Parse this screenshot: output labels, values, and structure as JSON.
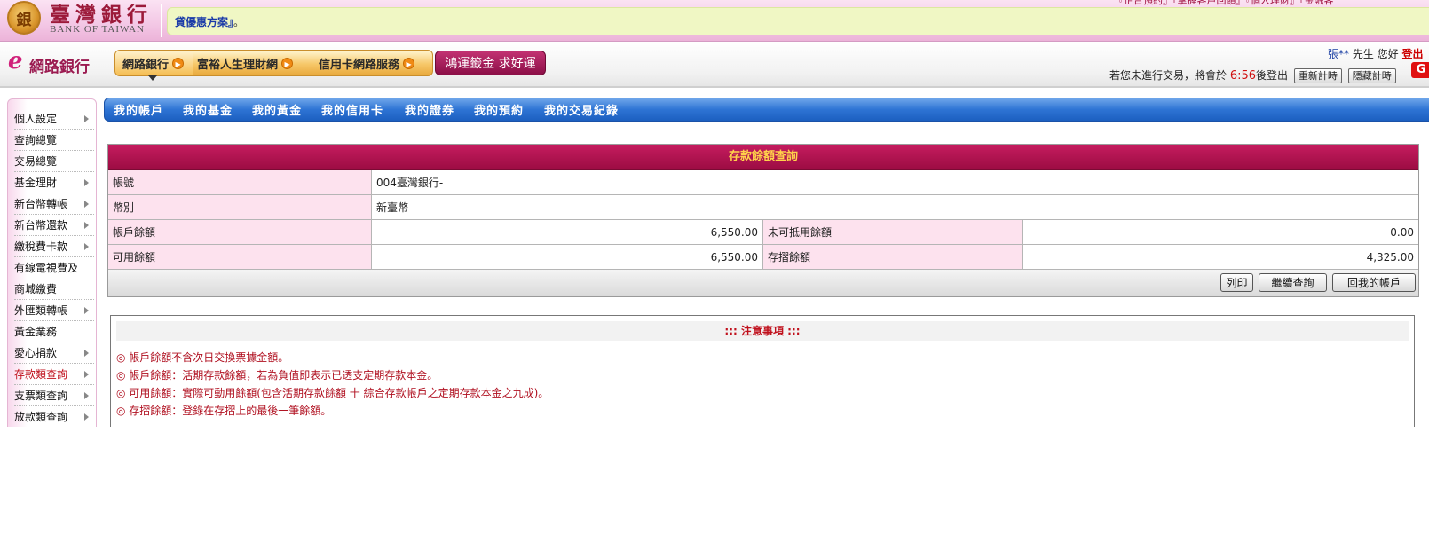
{
  "banner": {
    "logo_seal": "銀",
    "logo_cn": "臺灣銀行",
    "logo_en": "BANK OF TAIWAN",
    "marquee_main": "貸優惠方案』",
    "marquee_tail": "。",
    "top_links": "『企台預約』『掌握客戶回饋』『個人理財』『金融客"
  },
  "ebank": {
    "logo_e": "e",
    "logo_text": "網路銀行",
    "nav": [
      "網路銀行",
      "富裕人生理財網",
      "信用卡網路服務"
    ],
    "promo": "鴻運籤金 求好運",
    "greeting_name": "張**",
    "greeting_suffix": " 先生 您好 ",
    "logout": "登出",
    "session_prefix": "若您未進行交易，將會於 ",
    "session_time": "6:56",
    "session_suffix": "後登出",
    "btn_renew": "重新計時",
    "btn_hide": "隱藏計時",
    "corner_icon": "G"
  },
  "sidebar": [
    {
      "label": "個人設定",
      "arrow": true
    },
    {
      "label": "查詢總覽",
      "arrow": false
    },
    {
      "label": "交易總覽",
      "arrow": false
    },
    {
      "label": "基金理財",
      "arrow": true
    },
    {
      "label": "新台幣轉帳",
      "arrow": true
    },
    {
      "label": "新台幣還款",
      "arrow": true
    },
    {
      "label": "繳稅費卡款",
      "arrow": true
    },
    {
      "label": "有線電視費及商城繳費",
      "arrow": false
    },
    {
      "label": "外匯類轉帳",
      "arrow": true
    },
    {
      "label": "黃金業務",
      "arrow": false
    },
    {
      "label": "愛心捐款",
      "arrow": true
    },
    {
      "label": "存款類查詢",
      "arrow": true
    },
    {
      "label": "支票類查詢",
      "arrow": true
    },
    {
      "label": "放款類查詢",
      "arrow": true
    }
  ],
  "tabs": [
    "我的帳戶",
    "我的基金",
    "我的黃金",
    "我的信用卡",
    "我的證券",
    "我的預約",
    "我的交易紀錄"
  ],
  "panel": {
    "title": "存款餘額查詢",
    "account_label": "帳號",
    "account_value": "004臺灣銀行-",
    "currency_label": "幣別",
    "currency_value": "新臺幣",
    "balance_label": "帳戶餘額",
    "balance_value": "6,550.00",
    "unclear_label": "未可抵用餘額",
    "unclear_value": "0.00",
    "available_label": "可用餘額",
    "available_value": "6,550.00",
    "passbook_label": "存摺餘額",
    "passbook_value": "4,325.00",
    "btn_print": "列印",
    "btn_continue": "繼續查詢",
    "btn_back": "回我的帳戶"
  },
  "notes": {
    "title": "::: 注意事項 :::",
    "items": [
      "◎ 帳戶餘額不含次日交換票據金額。",
      "◎ 帳戶餘額：活期存款餘額，若為負值即表示已透支定期存款本金。",
      "◎ 可用餘額：實際可動用餘額(包含活期存款餘額 十 綜合存款帳戶之定期存款本金之九成)。",
      "◎ 存摺餘額：登錄在存摺上的最後一筆餘額。"
    ]
  }
}
